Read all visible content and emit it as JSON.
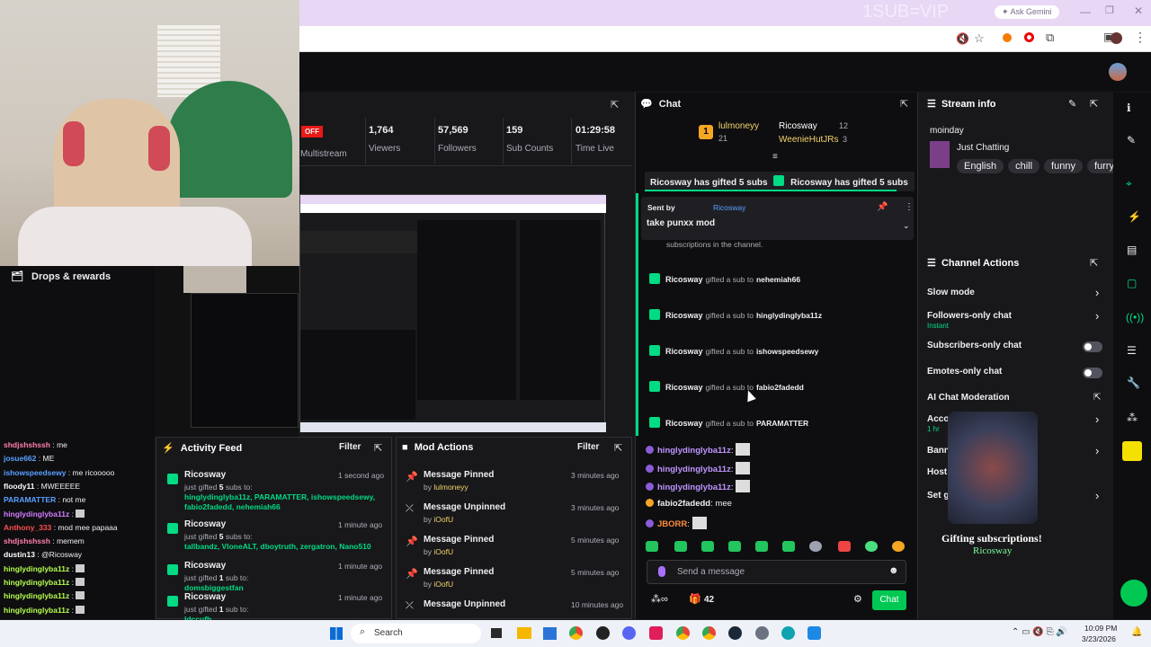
{
  "browser": {
    "overlay_text": "1SUB=VIP",
    "ask_gemini": "Ask Gemini"
  },
  "stream_stats": {
    "off_badge": "OFF",
    "multistream": "Multistream",
    "viewers": {
      "value": "1,764",
      "label": "Viewers"
    },
    "followers": {
      "value": "57,569",
      "label": "Followers"
    },
    "subs": {
      "value": "159",
      "label": "Sub Counts"
    },
    "time": {
      "value": "01:29:58",
      "label": "Time Live"
    }
  },
  "drops": {
    "label": "Drops & rewards"
  },
  "chat": {
    "title": "Chat",
    "leaderboard": [
      {
        "name": "lulmoneyy",
        "count": "21",
        "rank": "1"
      },
      {
        "name": "Ricosway",
        "count": "12"
      },
      {
        "name": "WeenieHutJRs",
        "count": "3"
      }
    ],
    "ticker": [
      "Ricosway has gifted 5 subs",
      "Ricosway has gifted 5 subs"
    ],
    "pinned": {
      "sent_by": "Sent by",
      "user": "Ricosway",
      "text": "take punxx mod",
      "sub_text": "subscriptions in the channel."
    },
    "gift_lines": [
      {
        "gifter": "Ricosway",
        "action": "gifted a sub to",
        "recipient": "nehemiah66"
      },
      {
        "gifter": "Ricosway",
        "action": "gifted a sub to",
        "recipient": "hinglydinglyba11z"
      },
      {
        "gifter": "Ricosway",
        "action": "gifted a sub to",
        "recipient": "ishowspeedsewy"
      },
      {
        "gifter": "Ricosway",
        "action": "gifted a sub to",
        "recipient": "fabio2fadedd"
      },
      {
        "gifter": "Ricosway",
        "action": "gifted a sub to",
        "recipient": "PARAMATTER"
      }
    ],
    "messages": [
      {
        "user": "hinglydinglyba11z",
        "text": ""
      },
      {
        "user": "hinglydinglyba11z",
        "text": ""
      },
      {
        "user": "hinglydinglyba11z",
        "text": ""
      },
      {
        "user": "fabio2fadedd",
        "text": "mee"
      },
      {
        "user": "JBORR",
        "text": ""
      }
    ],
    "input_placeholder": "Send a message",
    "points": "42",
    "send_label": "Chat"
  },
  "stream_info": {
    "title": "Stream info",
    "stream_title": "moinday",
    "category": "Just Chatting",
    "tags": [
      "English",
      "chill",
      "funny",
      "furry"
    ]
  },
  "channel_actions": {
    "title": "Channel Actions",
    "items": [
      {
        "label": "Slow mode",
        "sub": ""
      },
      {
        "label": "Followers-only chat",
        "sub": "Instant"
      },
      {
        "label": "Subscribers-only chat",
        "sub": ""
      },
      {
        "label": "Emotes-only chat",
        "sub": ""
      },
      {
        "label": "AI Chat Moderation",
        "sub": ""
      },
      {
        "label": "Acco",
        "sub": "1 hr"
      },
      {
        "label": "Bann",
        "sub": ""
      },
      {
        "label": "Host",
        "sub": ""
      },
      {
        "label": "Set g",
        "sub": ""
      }
    ]
  },
  "gift_overlay": {
    "title": "Gifting subscriptions!",
    "user": "Ricosway"
  },
  "activity_feed": {
    "title": "Activity Feed",
    "filter": "Filter",
    "items": [
      {
        "user": "Ricosway",
        "time": "1 second ago",
        "text_pre": "just gifted ",
        "count": "5",
        "text_post": " subs to:",
        "recipients": "hinglydinglyba11z, PARAMATTER, ishowspeedsewy, fabio2fadedd, nehemiah66"
      },
      {
        "user": "Ricosway",
        "time": "1 minute ago",
        "text_pre": "just gifted ",
        "count": "5",
        "text_post": " subs to:",
        "recipients": "tallbandz, VloneALT, dboytruth, zergatron, Nano510"
      },
      {
        "user": "Ricosway",
        "time": "1 minute ago",
        "text_pre": "just gifted ",
        "count": "1",
        "text_post": " sub to:",
        "recipients": "domsbiggestfan"
      },
      {
        "user": "Ricosway",
        "time": "1 minute ago",
        "text_pre": "just gifted ",
        "count": "1",
        "text_post": " sub to:",
        "recipients": "ldccufh"
      }
    ]
  },
  "mod_actions": {
    "title": "Mod Actions",
    "filter": "Filter",
    "items": [
      {
        "action": "Message Pinned",
        "by": "by",
        "user": "lulmoneyy",
        "time": "3 minutes ago"
      },
      {
        "action": "Message Unpinned",
        "by": "by",
        "user": "iOofU",
        "time": "3 minutes ago"
      },
      {
        "action": "Message Pinned",
        "by": "by",
        "user": "iOofU",
        "time": "5 minutes ago"
      },
      {
        "action": "Message Pinned",
        "by": "by",
        "user": "iOofU",
        "time": "5 minutes ago"
      },
      {
        "action": "Message Unpinned",
        "by": "by",
        "user": "",
        "time": "10 minutes ago"
      }
    ]
  },
  "left_chat": [
    {
      "user": "shdjshshssh",
      "text": "me",
      "color": "#ff7fb0"
    },
    {
      "user": "josue662",
      "text": "ME",
      "color": "#5aa0ff"
    },
    {
      "user": "ishowspeedsewy",
      "text": "me ricooooo",
      "color": "#5aa0ff"
    },
    {
      "user": "floody11",
      "text": "MWEEEEE",
      "color": "#fff"
    },
    {
      "user": "PARAMATTER",
      "text": "not me",
      "color": "#5aa0ff"
    },
    {
      "user": "hinglydinglyba11z",
      "text": "",
      "color": "#d27cff"
    },
    {
      "user": "Anthony_333",
      "text": "mod mee papaaa",
      "color": "#ff4d4d"
    },
    {
      "user": "shdjshshssh",
      "text": "memem",
      "color": "#ff7fb0"
    },
    {
      "user": "dustin13",
      "text": "@Ricosway",
      "color": "#fff"
    },
    {
      "user": "hinglydinglyba11z",
      "text": "",
      "color": "#b6ff4d"
    },
    {
      "user": "hinglydinglyba11z",
      "text": "",
      "color": "#b6ff4d"
    },
    {
      "user": "hinglydinglyba11z",
      "text": "",
      "color": "#b6ff4d"
    },
    {
      "user": "hinglydinglyba11z",
      "text": "",
      "color": "#b6ff4d"
    },
    {
      "user": "fabio2fadedd",
      "text": "mee",
      "color": "#5aa0ff"
    }
  ],
  "taskbar": {
    "search": "Search",
    "time": "10:09 PM",
    "date": "3/23/2026"
  },
  "colors": {
    "accent": "#00db84",
    "brand": "#9147ff",
    "chat_btn": "#00c853"
  }
}
